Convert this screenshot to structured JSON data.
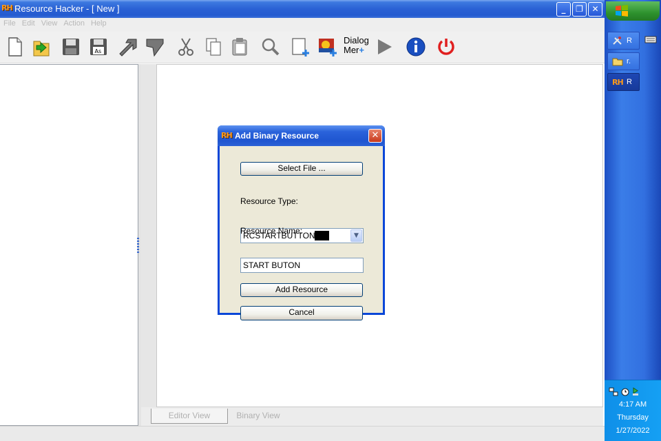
{
  "window": {
    "title": "Resource Hacker - [ New ]",
    "logo_text": "RH",
    "controls": {
      "minimize": "_",
      "maximize": "❐",
      "close": "✕"
    }
  },
  "menu": {
    "items": [
      {
        "label": "File"
      },
      {
        "label": "Edit"
      },
      {
        "label": "View"
      },
      {
        "label": "Action"
      },
      {
        "label": "Help"
      }
    ]
  },
  "toolbar": {
    "icons": [
      "new-file-icon",
      "open-file-icon",
      "save-icon",
      "save-as-icon",
      "compile-arrow-icon",
      "bookmark-arrow-icon",
      "cut-icon",
      "copy-icon",
      "paste-icon",
      "find-icon",
      "add-resource-icon",
      "add-image-resource-icon",
      "dialog-menu-icon",
      "run-icon",
      "info-icon",
      "power-icon"
    ],
    "save_as_label": "As",
    "dialog_menu_line1": "Dialog",
    "dialog_menu_line2": "Mer"
  },
  "tabs": {
    "editor_view": "Editor View",
    "binary_view": "Binary View"
  },
  "dialog": {
    "logo_text": "RH",
    "title": "Add Binary Resource",
    "close": "✕",
    "select_file_label": "Select File ...",
    "resource_type_label": "Resource Type:",
    "resource_type_value": "RCSTARTBUTTON",
    "resource_name_label": "Resource Name:",
    "resource_name_value": "START BUTON",
    "add_resource_label": "Add Resource",
    "cancel_label": "Cancel"
  },
  "taskbar": {
    "buttons": [
      {
        "label": "R",
        "icon": "tools-icon"
      },
      {
        "label": "r.",
        "icon": "folder-icon"
      },
      {
        "label": "R",
        "icon": "rh-app-icon",
        "logo_text": "RH",
        "active": true
      }
    ],
    "tray": {
      "time": "4:17 AM",
      "day": "Thursday",
      "date": "1/27/2022"
    }
  },
  "colors": {
    "titlebar": "#245bd0",
    "dialog_face": "#ece9d8",
    "taskbar": "#3270e0",
    "tray": "#15a0f4",
    "start": "#2e922e"
  }
}
